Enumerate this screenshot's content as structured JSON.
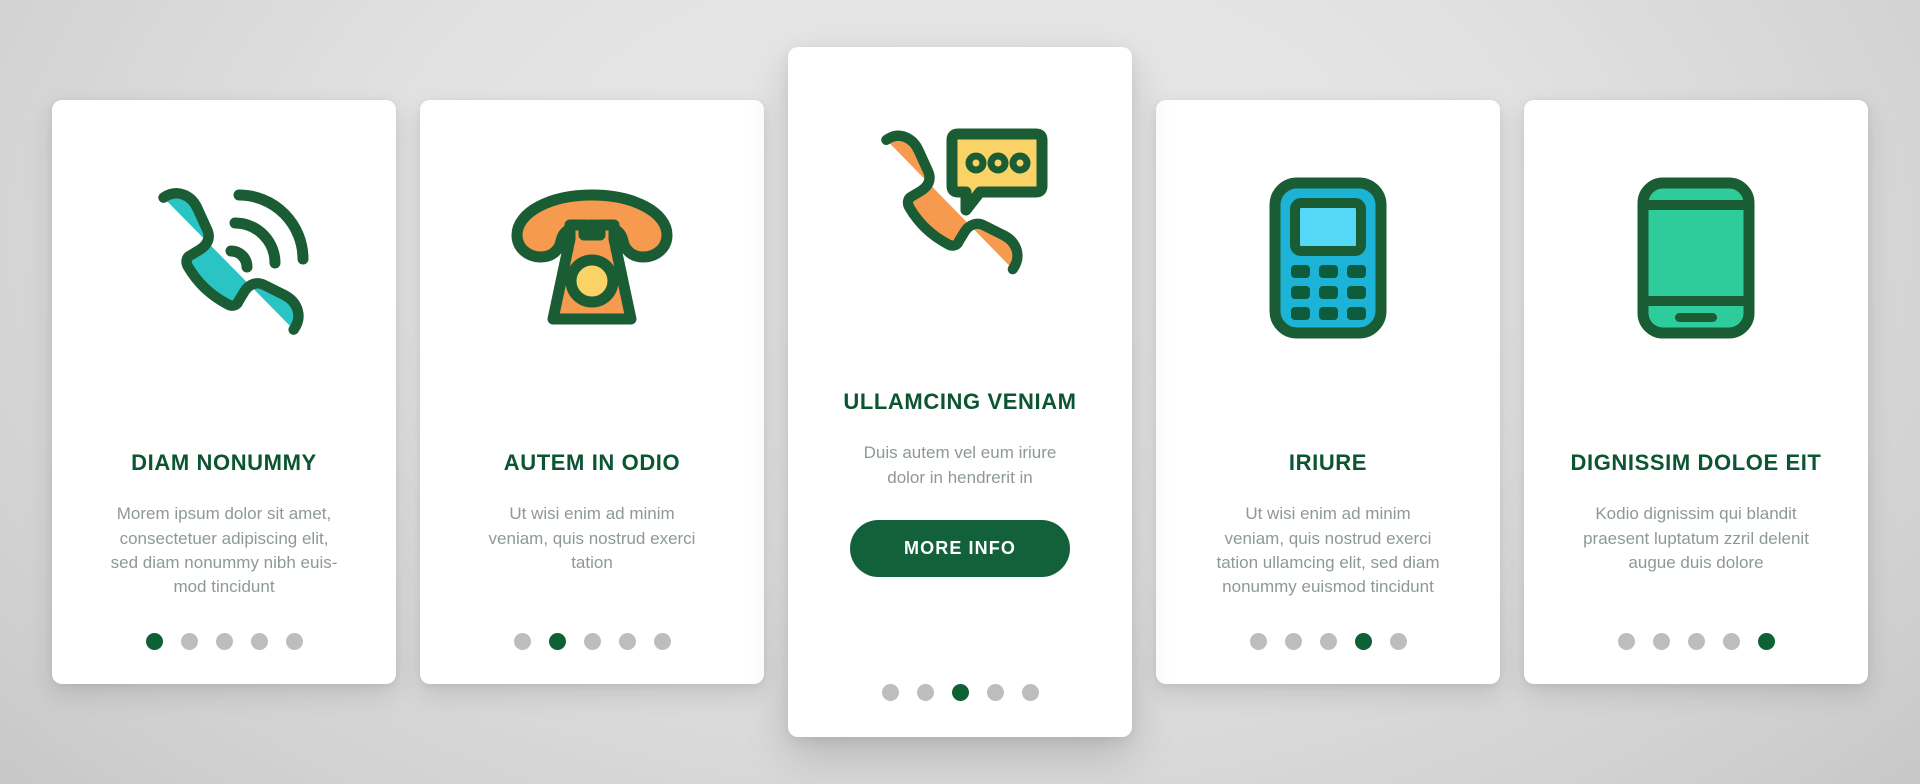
{
  "theme": {
    "accent_green": "#0b5532",
    "button_green": "#12613a",
    "body_text": "#8e9a91",
    "dot_inactive": "#bdbdbd",
    "dot_active": "#0d6135",
    "card_bg": "#ffffff",
    "outline": "#1a5c33",
    "cyan": "#2bc4c4",
    "orange": "#f59a4e",
    "yellow": "#fbd266",
    "light_blue": "#3ecff4",
    "mint": "#2ecc9a"
  },
  "cards": [
    {
      "icon": "phone-ringing-icon",
      "title": "DIAM NONUMMY",
      "body": "Morem ipsum dolor sit amet,\nconsectetuer adipiscing elit,\nsed diam nonummy nibh euis-\nmod tincidunt",
      "dots_total": 5,
      "dot_active_index": 0,
      "featured": false
    },
    {
      "icon": "rotary-phone-icon",
      "title": "AUTEM IN ODIO",
      "body": "Ut wisi enim ad minim\nveniam, quis nostrud exerci\ntation",
      "dots_total": 5,
      "dot_active_index": 1,
      "featured": false
    },
    {
      "icon": "phone-chat-icon",
      "title": "ULLAMCING VENIAM",
      "body": "Duis autem vel eum iriure\ndolor in hendrerit in",
      "button_label": "MORE INFO",
      "dots_total": 5,
      "dot_active_index": 2,
      "featured": true
    },
    {
      "icon": "feature-phone-icon",
      "title": "IRIURE",
      "body": "Ut wisi enim ad minim\nveniam, quis nostrud exerci\ntation ullamcing elit, sed diam\nnonummy euismod tincidunt",
      "dots_total": 5,
      "dot_active_index": 3,
      "featured": false
    },
    {
      "icon": "smartphone-icon",
      "title": "DIGNISSIM DOLOE EIT",
      "body": "Kodio dignissim qui blandit\npraesent luptatum zzril delenit\naugue duis dolore",
      "dots_total": 5,
      "dot_active_index": 4,
      "featured": false
    }
  ]
}
